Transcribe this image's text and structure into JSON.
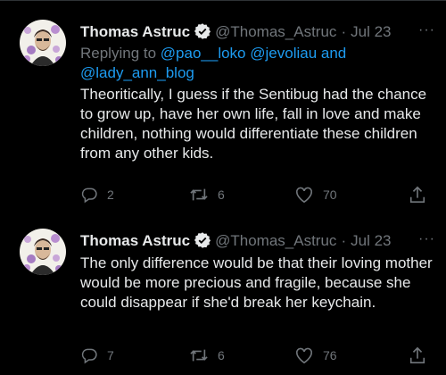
{
  "tweets": [
    {
      "author_name": "Thomas Astruc",
      "handle": "@Thomas_Astruc",
      "separator": "·",
      "date": "Jul 23",
      "more": "···",
      "replying_prefix": "Replying to",
      "replying_links": [
        "@pao__loko",
        "@jevoliau",
        "@lady_ann_blog"
      ],
      "replying_and": "and",
      "text": "Theoritically, I guess if the Sentibug had the chance to grow up, have her own life, fall in love and make children, nothing would differentiate these children from any other kids.",
      "replies": "2",
      "retweets": "6",
      "likes": "70"
    },
    {
      "author_name": "Thomas Astruc",
      "handle": "@Thomas_Astruc",
      "separator": "·",
      "date": "Jul 23",
      "more": "···",
      "text": "The only difference would be that their loving mother would be more precious and fragile, because she could disappear if she'd break her keychain.",
      "replies": "7",
      "retweets": "6",
      "likes": "76"
    }
  ],
  "icons": {
    "verified": "verified-badge-icon",
    "reply": "reply-icon",
    "retweet": "retweet-icon",
    "like": "heart-icon",
    "share": "share-icon"
  },
  "colors": {
    "background": "#000000",
    "text": "#e7e9ea",
    "secondary": "#71767b",
    "link": "#1d9bf0"
  }
}
